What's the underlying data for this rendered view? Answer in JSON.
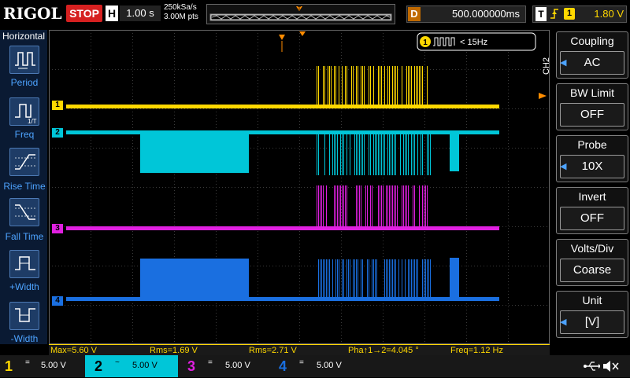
{
  "header": {
    "logo": "RIGOL",
    "run_state": "STOP",
    "time_mode": "H",
    "timebase": "1.00 s",
    "sample_rate": "250kSa/s",
    "memory_depth": "3.00M pts",
    "trigger_marker": "T",
    "delay_label": "D",
    "delay_value": "500.000000ms",
    "trigger_mode": "T",
    "trigger_source": "1",
    "trigger_level": "1.80 V"
  },
  "left_menu": {
    "title": "Horizontal",
    "items": [
      {
        "label": "Period",
        "icon": "period-icon"
      },
      {
        "label": "Freq",
        "icon": "freq-icon"
      },
      {
        "label": "Rise Time",
        "icon": "rise-time-icon"
      },
      {
        "label": "Fall Time",
        "icon": "fall-time-icon"
      },
      {
        "label": "+Width",
        "icon": "plus-width-icon"
      },
      {
        "label": "-Width",
        "icon": "minus-width-icon"
      }
    ]
  },
  "screen": {
    "freq_counter_channel": "1",
    "freq_counter_value": "< 15Hz",
    "channel_markers": [
      "1",
      "2",
      "3",
      "4"
    ]
  },
  "right_menu": {
    "channel_label": "CH2",
    "items": [
      {
        "title": "Coupling",
        "value": "AC"
      },
      {
        "title": "BW Limit",
        "value": "OFF"
      },
      {
        "title": "Probe",
        "value": "10X"
      },
      {
        "title": "Invert",
        "value": "OFF"
      },
      {
        "title": "Volts/Div",
        "value": "Coarse"
      },
      {
        "title": "Unit",
        "value": "[V]"
      }
    ]
  },
  "measurements": [
    "Max=5.60 V",
    "Rms=1.69 V",
    "Rms=2.71 V",
    "Pha↑1→2=4.045 °",
    "Freq=1.12 Hz"
  ],
  "channels": [
    {
      "num": "1",
      "coupling": "=",
      "scale": "5.00 V",
      "color": "#ffd800"
    },
    {
      "num": "2",
      "coupling": "~",
      "scale": "5.00 V",
      "color": "#00c6d8"
    },
    {
      "num": "3",
      "coupling": "=",
      "scale": "5.00 V",
      "color": "#e020e0"
    },
    {
      "num": "4",
      "coupling": "=",
      "scale": "5.00 V",
      "color": "#1a6fe0"
    }
  ],
  "colors": {
    "ch1": "#ffd800",
    "ch2": "#00c6d8",
    "ch3": "#e020e0",
    "ch4": "#1a6fe0",
    "trigger": "#ff8c00"
  }
}
